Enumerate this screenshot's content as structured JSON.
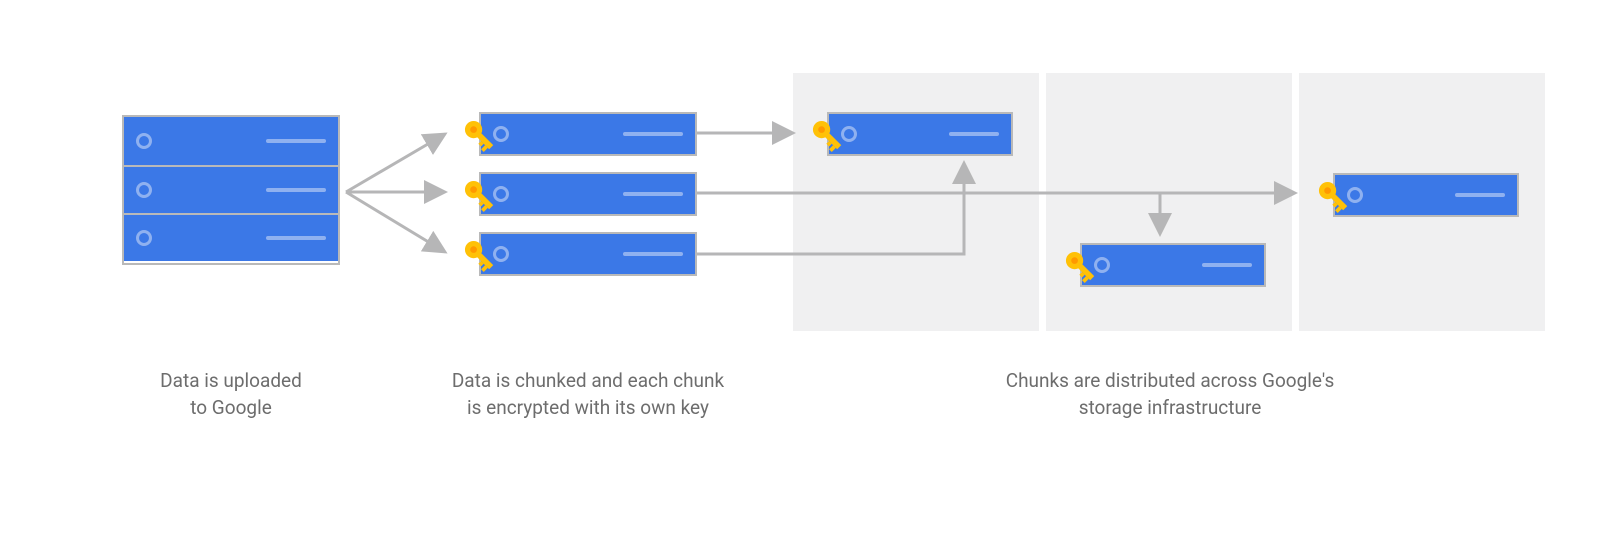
{
  "captions": {
    "upload": "Data is uploaded\nto Google",
    "chunked": "Data is chunked and each chunk\nis encrypted with its own key",
    "distributed": "Chunks are distributed across Google's\nstorage infrastructure"
  },
  "colors": {
    "server_fill": "#3B78E7",
    "server_accent": "#8fb1f0",
    "border": "#b9b9b9",
    "storage_bg": "#f0f0f1",
    "key_yellow": "#ffc107",
    "key_orange": "#ff9900",
    "caption_text": "#6d6d6d",
    "arrow": "#b6b6b7"
  }
}
